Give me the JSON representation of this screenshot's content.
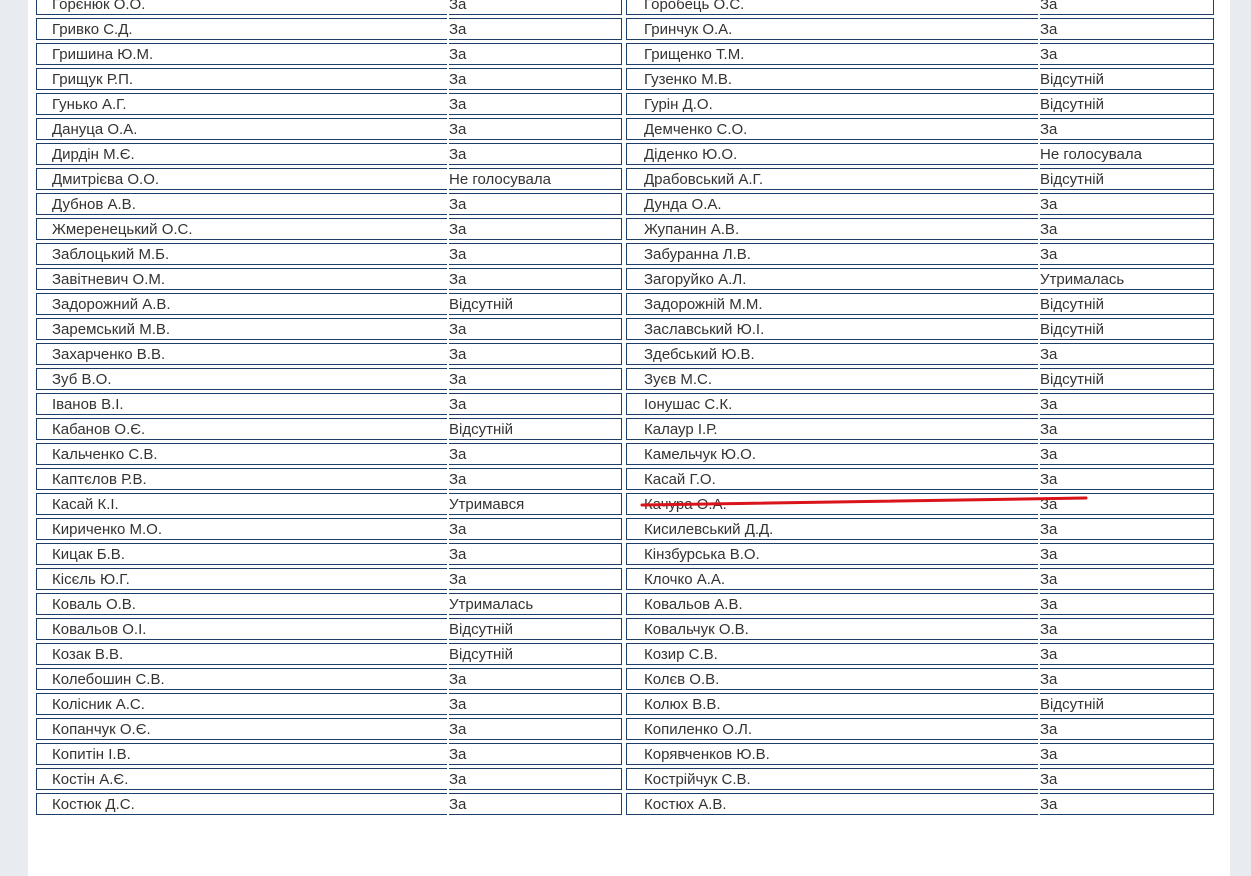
{
  "rows": [
    {
      "left": {
        "name": "Горєнюк О.О.",
        "vote": "За",
        "kind": "za"
      },
      "right": {
        "name": "Горобець О.С.",
        "vote": "За",
        "kind": "za"
      }
    },
    {
      "left": {
        "name": "Гривко С.Д.",
        "vote": "За",
        "kind": "za"
      },
      "right": {
        "name": "Гринчук О.А.",
        "vote": "За",
        "kind": "za"
      }
    },
    {
      "left": {
        "name": "Гришина Ю.М.",
        "vote": "За",
        "kind": "za"
      },
      "right": {
        "name": "Грищенко Т.М.",
        "vote": "За",
        "kind": "za"
      }
    },
    {
      "left": {
        "name": "Грищук Р.П.",
        "vote": "За",
        "kind": "za"
      },
      "right": {
        "name": "Гузенко М.В.",
        "vote": "Відсутній",
        "kind": "absent"
      }
    },
    {
      "left": {
        "name": "Гунько А.Г.",
        "vote": "За",
        "kind": "za"
      },
      "right": {
        "name": "Гурін Д.О.",
        "vote": "Відсутній",
        "kind": "absent"
      }
    },
    {
      "left": {
        "name": "Дануца О.А.",
        "vote": "За",
        "kind": "za"
      },
      "right": {
        "name": "Демченко С.О.",
        "vote": "За",
        "kind": "za"
      }
    },
    {
      "left": {
        "name": "Дирдін М.Є.",
        "vote": "За",
        "kind": "za"
      },
      "right": {
        "name": "Діденко Ю.О.",
        "vote": "Не голосувала",
        "kind": "novote"
      }
    },
    {
      "left": {
        "name": "Дмитрієва О.О.",
        "vote": "Не голосувала",
        "kind": "novote"
      },
      "right": {
        "name": "Драбовський А.Г.",
        "vote": "Відсутній",
        "kind": "absent"
      }
    },
    {
      "left": {
        "name": "Дубнов А.В.",
        "vote": "За",
        "kind": "za"
      },
      "right": {
        "name": "Дунда О.А.",
        "vote": "За",
        "kind": "za"
      }
    },
    {
      "left": {
        "name": "Жмеренецький О.С.",
        "vote": "За",
        "kind": "za"
      },
      "right": {
        "name": "Жупанин А.В.",
        "vote": "За",
        "kind": "za"
      }
    },
    {
      "left": {
        "name": "Заблоцький М.Б.",
        "vote": "За",
        "kind": "za"
      },
      "right": {
        "name": "Забуранна Л.В.",
        "vote": "За",
        "kind": "za"
      }
    },
    {
      "left": {
        "name": "Завітневич О.М.",
        "vote": "За",
        "kind": "za"
      },
      "right": {
        "name": "Загоруйко А.Л.",
        "vote": "Утрималась",
        "kind": "abstain"
      }
    },
    {
      "left": {
        "name": "Задорожний А.В.",
        "vote": "Відсутній",
        "kind": "absent"
      },
      "right": {
        "name": "Задорожній М.М.",
        "vote": "Відсутній",
        "kind": "absent"
      }
    },
    {
      "left": {
        "name": "Заремський М.В.",
        "vote": "За",
        "kind": "za"
      },
      "right": {
        "name": "Заславський Ю.І.",
        "vote": "Відсутній",
        "kind": "absent"
      }
    },
    {
      "left": {
        "name": "Захарченко В.В.",
        "vote": "За",
        "kind": "za"
      },
      "right": {
        "name": "Здебський Ю.В.",
        "vote": "За",
        "kind": "za"
      }
    },
    {
      "left": {
        "name": "Зуб В.О.",
        "vote": "За",
        "kind": "za"
      },
      "right": {
        "name": "Зуєв М.С.",
        "vote": "Відсутній",
        "kind": "absent"
      }
    },
    {
      "left": {
        "name": "Іванов В.І.",
        "vote": "За",
        "kind": "za"
      },
      "right": {
        "name": "Іонушас С.К.",
        "vote": "За",
        "kind": "za"
      }
    },
    {
      "left": {
        "name": "Кабанов О.Є.",
        "vote": "Відсутній",
        "kind": "absent"
      },
      "right": {
        "name": "Калаур І.Р.",
        "vote": "За",
        "kind": "za"
      }
    },
    {
      "left": {
        "name": "Кальченко С.В.",
        "vote": "За",
        "kind": "za"
      },
      "right": {
        "name": "Камельчук Ю.О.",
        "vote": "За",
        "kind": "za"
      }
    },
    {
      "left": {
        "name": "Каптєлов Р.В.",
        "vote": "За",
        "kind": "za"
      },
      "right": {
        "name": "Касай Г.О.",
        "vote": "За",
        "kind": "za"
      }
    },
    {
      "left": {
        "name": "Касай К.І.",
        "vote": "Утримався",
        "kind": "abstain"
      },
      "right": {
        "name": "Качура О.А.",
        "vote": "За",
        "kind": "za"
      }
    },
    {
      "left": {
        "name": "Кириченко М.О.",
        "vote": "За",
        "kind": "za"
      },
      "right": {
        "name": "Кисилевський Д.Д.",
        "vote": "За",
        "kind": "za"
      }
    },
    {
      "left": {
        "name": "Кицак Б.В.",
        "vote": "За",
        "kind": "za"
      },
      "right": {
        "name": "Кінзбурська В.О.",
        "vote": "За",
        "kind": "za"
      }
    },
    {
      "left": {
        "name": "Кісєль Ю.Г.",
        "vote": "За",
        "kind": "za"
      },
      "right": {
        "name": "Клочко А.А.",
        "vote": "За",
        "kind": "za"
      }
    },
    {
      "left": {
        "name": "Коваль О.В.",
        "vote": "Утрималась",
        "kind": "abstain"
      },
      "right": {
        "name": "Ковальов А.В.",
        "vote": "За",
        "kind": "za"
      }
    },
    {
      "left": {
        "name": "Ковальов О.І.",
        "vote": "Відсутній",
        "kind": "absent"
      },
      "right": {
        "name": "Ковальчук О.В.",
        "vote": "За",
        "kind": "za"
      }
    },
    {
      "left": {
        "name": "Козак В.В.",
        "vote": "Відсутній",
        "kind": "absent"
      },
      "right": {
        "name": "Козир С.В.",
        "vote": "За",
        "kind": "za"
      }
    },
    {
      "left": {
        "name": "Колебошин С.В.",
        "vote": "За",
        "kind": "za"
      },
      "right": {
        "name": "Колєв О.В.",
        "vote": "За",
        "kind": "za"
      }
    },
    {
      "left": {
        "name": "Колісник А.С.",
        "vote": "За",
        "kind": "za"
      },
      "right": {
        "name": "Колюх В.В.",
        "vote": "Відсутній",
        "kind": "absent"
      }
    },
    {
      "left": {
        "name": "Копанчук О.Є.",
        "vote": "За",
        "kind": "za"
      },
      "right": {
        "name": "Копиленко О.Л.",
        "vote": "За",
        "kind": "za"
      }
    },
    {
      "left": {
        "name": "Копитін І.В.",
        "vote": "За",
        "kind": "za"
      },
      "right": {
        "name": "Корявченков Ю.В.",
        "vote": "За",
        "kind": "za"
      }
    },
    {
      "left": {
        "name": "Костін А.Є.",
        "vote": "За",
        "kind": "za"
      },
      "right": {
        "name": "Кострійчук С.В.",
        "vote": "За",
        "kind": "za"
      }
    },
    {
      "left": {
        "name": "Костюк Д.С.",
        "vote": "За",
        "kind": "za"
      },
      "right": {
        "name": "Костюх А.В.",
        "vote": "За",
        "kind": "za"
      }
    }
  ],
  "highlight": {
    "color": "#d9141b"
  }
}
